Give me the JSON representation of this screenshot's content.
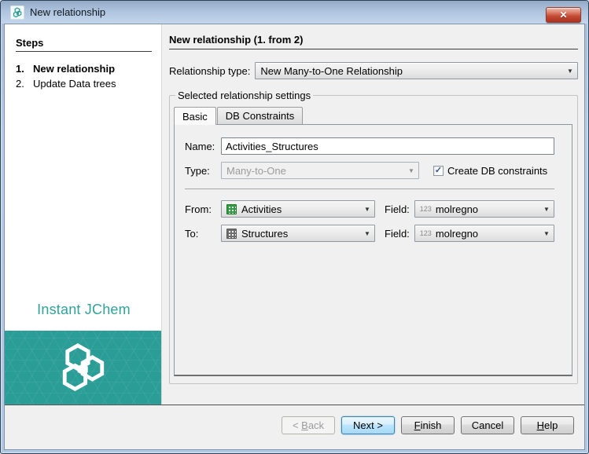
{
  "window": {
    "title": "New relationship"
  },
  "icons": {
    "dropdown": "▼",
    "close": "✕",
    "check": "✓"
  },
  "steps": {
    "header": "Steps",
    "items": [
      {
        "number": "1.",
        "label": "New relationship",
        "current": true
      },
      {
        "number": "2.",
        "label": "Update Data trees",
        "current": false
      }
    ]
  },
  "branding": {
    "product": "Instant JChem"
  },
  "main": {
    "heading": "New relationship (1. from 2)",
    "relationship_type": {
      "label": "Relationship type:",
      "value": "New Many-to-One Relationship"
    },
    "settings_group": {
      "label": "Selected relationship settings",
      "tabs": [
        {
          "label": "Basic",
          "active": true
        },
        {
          "label": "DB Constraints",
          "active": false
        }
      ],
      "form": {
        "name": {
          "label": "Name:",
          "value": "Activities_Structures"
        },
        "type": {
          "label": "Type:",
          "value": "Many-to-One",
          "disabled": true
        },
        "create_db_constraints": {
          "label": "Create DB constraints",
          "checked": true
        },
        "from": {
          "label": "From:",
          "value": "Activities",
          "table_icon": "green-table-icon",
          "field_label": "Field:",
          "field_icon": "123",
          "field_value": "molregno"
        },
        "to": {
          "label": "To:",
          "value": "Structures",
          "table_icon": "gray-table-icon",
          "field_label": "Field:",
          "field_icon": "123",
          "field_value": "molregno"
        }
      }
    }
  },
  "buttons": {
    "back": {
      "prefix": "< ",
      "key": "B",
      "suffix": "ack",
      "enabled": false
    },
    "next": {
      "label": "Next >",
      "default": true
    },
    "finish": {
      "key": "F",
      "suffix": "inish"
    },
    "cancel": {
      "label": "Cancel"
    },
    "help": {
      "key": "H",
      "suffix": "elp"
    }
  },
  "colors": {
    "accent_teal": "#2a9d96",
    "titlebar_blue": "#aec3dd",
    "default_button_border": "#3c7fb1",
    "green_table_icon": "#2f9e41",
    "gray_table_icon": "#6f6f6f"
  }
}
